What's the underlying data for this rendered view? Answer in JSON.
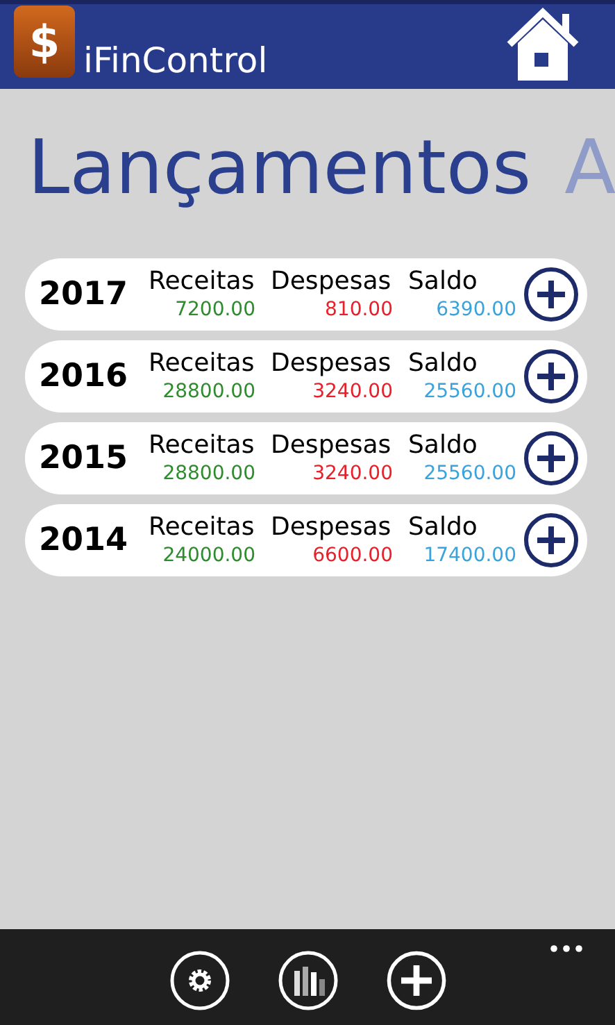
{
  "header": {
    "logo_symbol": "$",
    "app_name": "iFinControl"
  },
  "page_title": "Lançamentos",
  "next_pivot": "A",
  "years": [
    {
      "year": "2017",
      "income_label": "Receitas",
      "income": "7200.00",
      "expense_label": "Despesas",
      "expense": "810.00",
      "balance_label": "Saldo",
      "balance": "6390.00"
    },
    {
      "year": "2016",
      "income_label": "Receitas",
      "income": "28800.00",
      "expense_label": "Despesas",
      "expense": "3240.00",
      "balance_label": "Saldo",
      "balance": "25560.00"
    },
    {
      "year": "2015",
      "income_label": "Receitas",
      "income": "28800.00",
      "expense_label": "Despesas",
      "expense": "3240.00",
      "balance_label": "Saldo",
      "balance": "25560.00"
    },
    {
      "year": "2014",
      "income_label": "Receitas",
      "income": "24000.00",
      "expense_label": "Despesas",
      "expense": "6600.00",
      "balance_label": "Saldo",
      "balance": "17400.00"
    }
  ]
}
